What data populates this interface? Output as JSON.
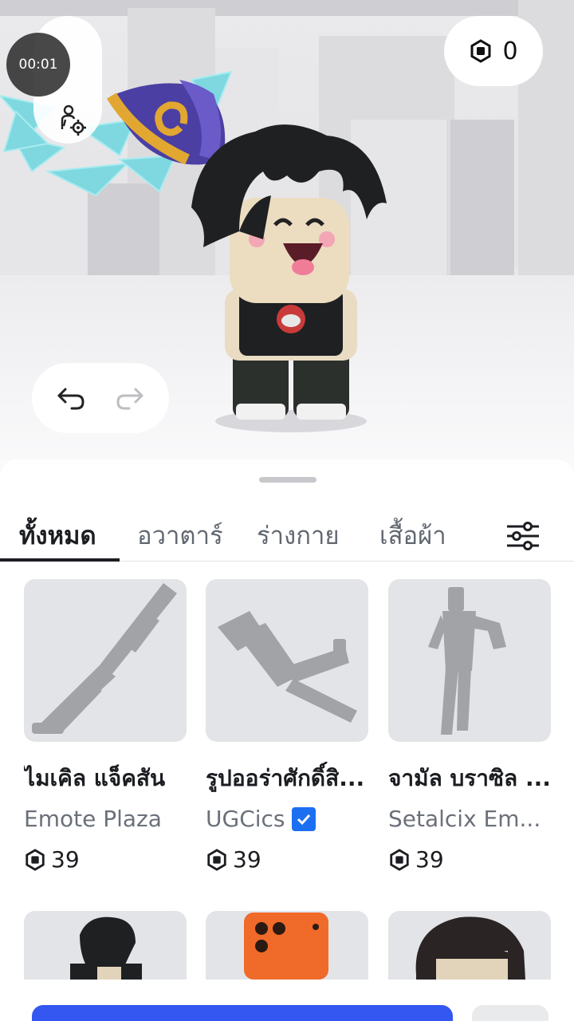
{
  "timer": {
    "text": "00:01"
  },
  "robux": {
    "balance": "0"
  },
  "tabs": [
    {
      "label": "ทั้งหมด",
      "active": true
    },
    {
      "label": "อวาตาร์",
      "active": false
    },
    {
      "label": "ร่างกาย",
      "active": false
    },
    {
      "label": "เสื้อผ้า",
      "active": false
    }
  ],
  "items": [
    {
      "name": "ไมเคิล แจ็คสัน",
      "creator": "Emote Plaza",
      "verified": false,
      "price": "39"
    },
    {
      "name": "รูปออร่าศักดิ์สิ...",
      "creator": "UGCics",
      "verified": true,
      "price": "39"
    },
    {
      "name": "จามัล บราซิล ...",
      "creator": "Setalcix Em...",
      "verified": false,
      "price": "39"
    }
  ],
  "colors": {
    "accent": "#3357f0",
    "verified": "#1d6ff2",
    "text": "#1b1d21",
    "subtext": "#6b7079"
  },
  "icons": {
    "robux": "robux-hexagon-icon",
    "undo": "undo-arrow-icon",
    "redo": "redo-arrow-icon",
    "filter": "sliders-filter-icon",
    "avatar_settings": "avatar-settings-icon"
  }
}
